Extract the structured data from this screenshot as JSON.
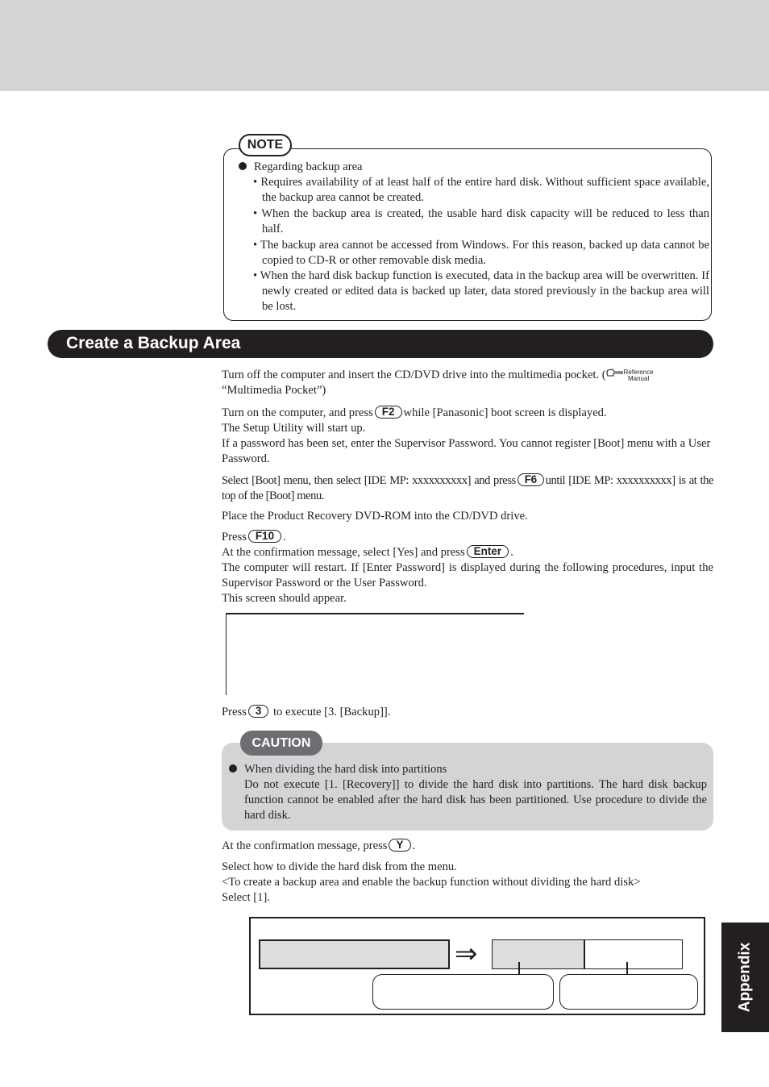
{
  "page": {
    "side_tab": "Appendix",
    "colors": {
      "header_band": "#d3d4d6",
      "dark": "#231f20",
      "caution_fill": "#d3d4d6",
      "caution_label": "#6d6e71"
    }
  },
  "note": {
    "label": "NOTE",
    "heading": "Regarding backup area",
    "items": [
      "• Requires availability of at least half of the entire hard disk.  Without sufficient space available, the backup area cannot be created.",
      "• When the backup area is created, the usable hard disk capacity will be reduced to less than half.",
      "• The backup area cannot be accessed from Windows.  For this reason, backed up data cannot be copied to CD-R or other removable disk media.",
      "• When the hard disk backup function is executed, data in the backup area will be overwritten.  If newly created or edited data is backed up later, data stored previously in the backup area will be lost."
    ]
  },
  "section": {
    "title": "Create a Backup Area"
  },
  "steps": {
    "s1_text": "Turn off the computer and insert the CD/DVD drive into the multimedia pocket. (",
    "s1_ref_line1": "Reference",
    "s1_ref_line2": "Manual",
    "s1_text2": "“Multimedia Pocket”)",
    "s2_pre": "Turn on the computer, and press",
    "s2_key": "F2",
    "s2_post": "while [Panasonic] boot screen is displayed.",
    "s2_line2": "The Setup Utility will start up.",
    "s2_line3": "If a password has been set, enter the Supervisor Password.  You cannot register [Boot] menu with a User Password.",
    "s3_pre": "Select [Boot] menu, then select [IDE MP:  xxxxxxxxxx] and press",
    "s3_key": "F6",
    "s3_post": "until [IDE MP:  xxxxxxxxxx] is at the top of the [Boot] menu.",
    "s4_text": "Place the Product Recovery DVD-ROM into the CD/DVD drive.",
    "s5_pre": "Press",
    "s5_key": "F10",
    "s5_post": ".",
    "s5_line2_pre": "At the confirmation message, select [Yes] and press",
    "s5_line2_key": "Enter",
    "s5_line2_post": ".",
    "s5_line3": "The computer will restart. If [Enter Password] is displayed during the following procedures, input the Supervisor Password or the User Password.",
    "s5_line4": "This screen should appear.",
    "s6_pre": "Press",
    "s6_key": "3",
    "s6_post": " to execute [3. [Backup]].",
    "s7_pre": "At the confirmation message, press",
    "s7_key": "Y",
    "s7_post": ".",
    "s8_line1": "Select how to divide the hard disk from the menu.",
    "s8_line2": "<To create a backup area and enable the backup function without dividing the hard disk>",
    "s8_line3": "Select [1]."
  },
  "caution": {
    "label": "CAUTION",
    "heading": "When dividing the hard disk into partitions",
    "text": "Do not execute [1. [Recovery]] to divide the hard disk into partitions.  The hard disk backup function cannot be enabled after the hard disk has been partitioned.  Use procedure    to divide the hard disk."
  },
  "diagram": {
    "arrow": "⇒"
  }
}
